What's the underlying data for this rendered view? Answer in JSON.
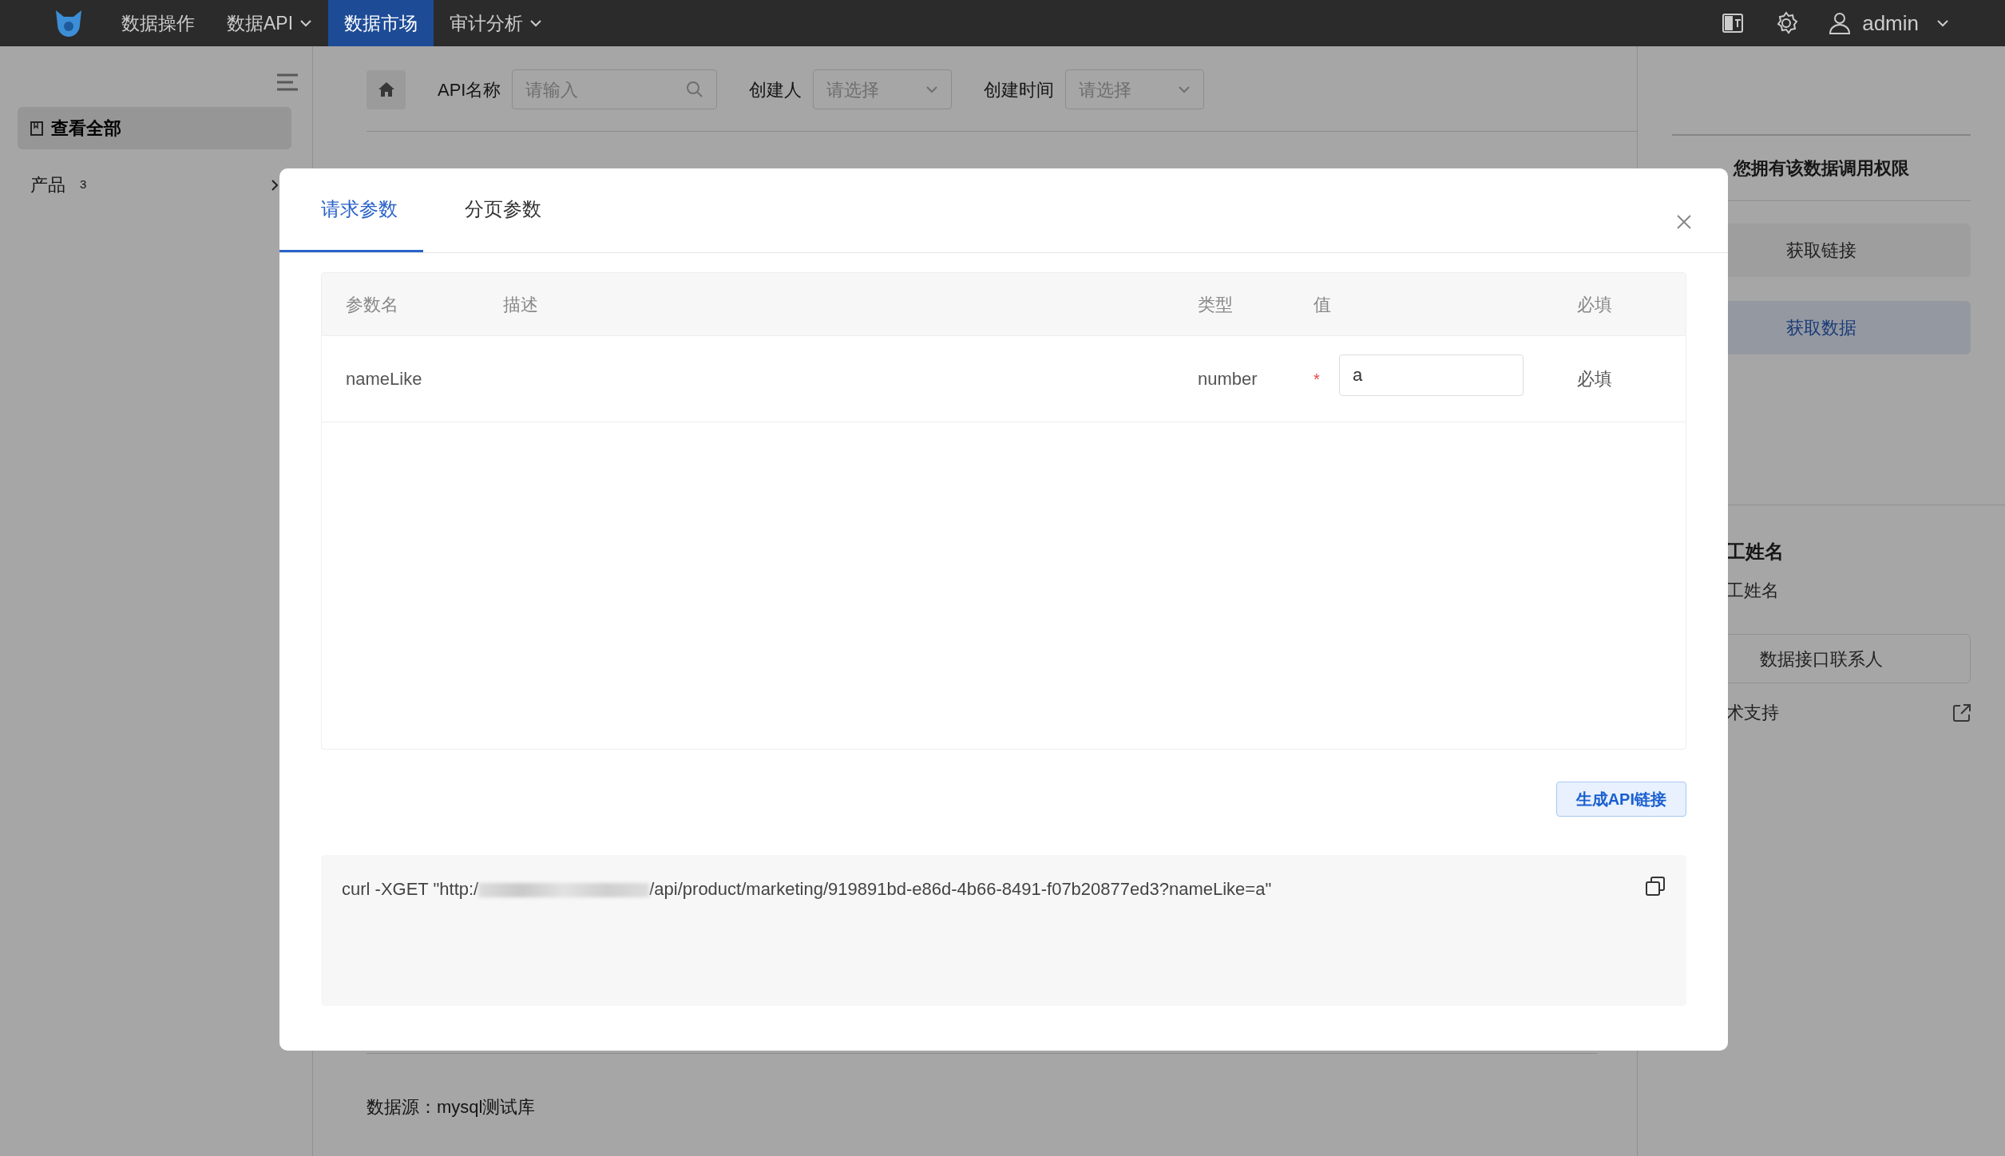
{
  "top_nav": {
    "menu": [
      {
        "label": "数据操作",
        "selected": false,
        "dropdown": false
      },
      {
        "label": "数据API",
        "selected": false,
        "dropdown": true
      },
      {
        "label": "数据市场",
        "selected": true,
        "dropdown": false
      },
      {
        "label": "审计分析",
        "selected": false,
        "dropdown": true
      }
    ],
    "user": "admin"
  },
  "sidebar": {
    "items": [
      {
        "label": "查看全部",
        "selected": true
      },
      {
        "label": "产品",
        "count": "3",
        "selected": false
      }
    ]
  },
  "filters": [
    {
      "label": "API名称",
      "kind": "search",
      "placeholder": "请输入"
    },
    {
      "label": "创建人",
      "kind": "select",
      "placeholder": "请选择"
    },
    {
      "label": "创建时间",
      "kind": "select",
      "placeholder": "请选择"
    }
  ],
  "data_source": "数据源：mysql测试库",
  "right_panel": {
    "permission": "您拥有该数据调用权限",
    "buttons": [
      {
        "label": "获取链接",
        "kind": "default"
      },
      {
        "label": "获取数据",
        "kind": "primary"
      }
    ],
    "heading": "工姓名",
    "subtext": "工姓名",
    "contact_button": "数据接口联系人",
    "support_link": "术支持"
  },
  "modal": {
    "tabs": [
      {
        "label": "请求参数",
        "selected": true
      },
      {
        "label": "分页参数",
        "selected": false
      }
    ],
    "table": {
      "columns": [
        "参数名",
        "描述",
        "类型",
        "值",
        "必填"
      ],
      "rows": [
        {
          "name": "nameLike",
          "type": "number",
          "required_mark": "*",
          "value": "a",
          "required_label": "必填"
        }
      ]
    },
    "generate_button": "生成API链接",
    "curl": {
      "prefix": "curl -XGET \"http:/",
      "suffix": "/api/product/marketing/919891bd-e86d-4b66-8491-f07b20877ed3?nameLike=a\""
    }
  }
}
